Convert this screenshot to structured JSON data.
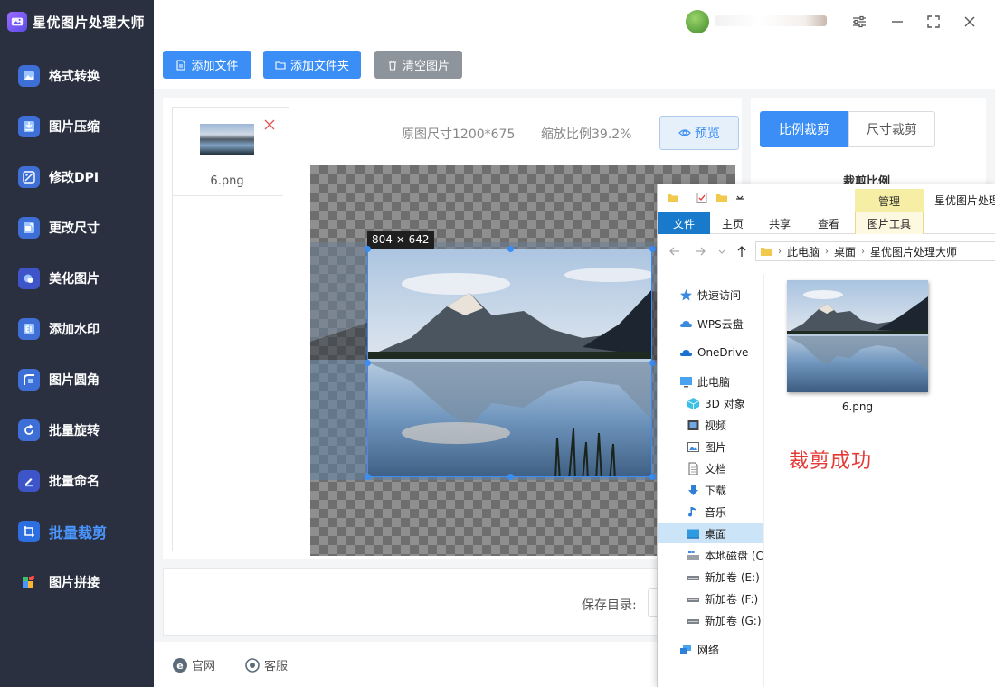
{
  "app": {
    "title": "星优图片处理大师"
  },
  "sidebar": {
    "items": [
      {
        "label": "格式转换",
        "icon": "image-convert-icon",
        "color": "#4a96ff"
      },
      {
        "label": "图片压缩",
        "icon": "compress-icon",
        "color": "#4a96ff"
      },
      {
        "label": "修改DPI",
        "icon": "dpi-icon",
        "color": "#4a96ff"
      },
      {
        "label": "更改尺寸",
        "icon": "resize-icon",
        "color": "#4a96ff"
      },
      {
        "label": "美化图片",
        "icon": "beautify-icon",
        "color": "#6a7bff"
      },
      {
        "label": "添加水印",
        "icon": "watermark-icon",
        "color": "#4a96ff"
      },
      {
        "label": "图片圆角",
        "icon": "rounded-corner-icon",
        "color": "#4a96ff"
      },
      {
        "label": "批量旋转",
        "icon": "rotate-icon",
        "color": "#4a96ff"
      },
      {
        "label": "批量命名",
        "icon": "rename-icon",
        "color": "#4a96ff"
      },
      {
        "label": "批量裁剪",
        "icon": "crop-icon",
        "color": "#4a96ff",
        "active": true
      },
      {
        "label": "图片拼接",
        "icon": "puzzle-icon",
        "color": "#ff4d4d"
      }
    ]
  },
  "toolbar": {
    "add_file": "添加文件",
    "add_folder": "添加文件夹",
    "clear_images": "清空图片"
  },
  "file_list": [
    {
      "name": "6.png"
    }
  ],
  "editor": {
    "original_size": "原图尺寸1200*675",
    "scale": "缩放比例39.2%",
    "preview": "预览",
    "crop_size": "804 × 642"
  },
  "save": {
    "label": "保存目录:"
  },
  "right_panel": {
    "tab_ratio": "比例裁剪",
    "tab_size": "尺寸裁剪",
    "ratio_label": "裁剪比例"
  },
  "footer": {
    "website": "官网",
    "support": "客服"
  },
  "explorer": {
    "context_tab": "管理",
    "title": "星优图片处理",
    "ribbon": [
      "文件",
      "主页",
      "共享",
      "查看"
    ],
    "ribbon_tool": "图片工具",
    "breadcrumb": [
      "此电脑",
      "桌面",
      "星优图片处理大师"
    ],
    "tree": [
      {
        "label": "快速访问",
        "icon": "star-icon"
      },
      {
        "label": "WPS云盘",
        "icon": "cloud-icon"
      },
      {
        "label": "OneDrive",
        "icon": "onedrive-icon"
      },
      {
        "label": "此电脑",
        "icon": "computer-icon"
      },
      {
        "label": "3D 对象",
        "icon": "cube-icon"
      },
      {
        "label": "视频",
        "icon": "video-icon"
      },
      {
        "label": "图片",
        "icon": "picture-icon"
      },
      {
        "label": "文档",
        "icon": "document-icon"
      },
      {
        "label": "下载",
        "icon": "download-icon"
      },
      {
        "label": "音乐",
        "icon": "music-icon"
      },
      {
        "label": "桌面",
        "icon": "desktop-icon",
        "selected": true
      },
      {
        "label": "本地磁盘 (C",
        "icon": "drive-c-icon"
      },
      {
        "label": "新加卷 (E:)",
        "icon": "drive-icon"
      },
      {
        "label": "新加卷 (F:)",
        "icon": "drive-icon"
      },
      {
        "label": "新加卷 (G:)",
        "icon": "drive-icon"
      },
      {
        "label": "网络",
        "icon": "network-icon"
      }
    ],
    "file": {
      "name": "6.png"
    }
  },
  "annotation": {
    "text": "裁剪成功",
    "color": "#e53935"
  },
  "colors": {
    "accent": "#3b8ef5",
    "sidebar_bg": "#2b3041"
  }
}
